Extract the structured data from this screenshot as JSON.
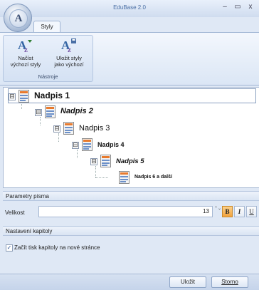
{
  "window": {
    "title": "EduBase 2.0",
    "minimize": "–",
    "maximize": "▭",
    "close": "x",
    "app_logo_letter": "A"
  },
  "ribbon": {
    "tab": "Styly",
    "group_label": "Nástroje",
    "buttons": [
      {
        "label_line1": "Načíst",
        "label_line2": "výchozí styly",
        "icon": "load-styles-icon"
      },
      {
        "label_line1": "Uložit styly",
        "label_line2": "jako výchozí",
        "icon": "save-styles-icon"
      }
    ]
  },
  "tree": {
    "items": [
      {
        "label": "Nadpis 1",
        "style": "bold",
        "selected": true
      },
      {
        "label": "Nadpis 2",
        "style": "bold-italic"
      },
      {
        "label": "Nadpis 3",
        "style": "normal"
      },
      {
        "label": "Nadpis 4",
        "style": "bold"
      },
      {
        "label": "Nadpis 5",
        "style": "bold-italic"
      },
      {
        "label": "Nadpis 6 a další",
        "style": "bold"
      }
    ],
    "expander": "⊟"
  },
  "font_params": {
    "header": "Parametry písma",
    "size_label": "Velikost",
    "size_value": "13",
    "spin": "⌃⌄",
    "bold": "B",
    "italic": "I",
    "underline": "U",
    "bold_active": true
  },
  "chapter": {
    "header": "Nastavení kapitoly",
    "checkbox_label": "Začít tisk kapitoly na nové stránce",
    "checked": true
  },
  "footer": {
    "save": "Uložit",
    "cancel": "Storno"
  },
  "colors": {
    "accent": "#4a6fa5",
    "bold_active": "#f6b25a"
  }
}
